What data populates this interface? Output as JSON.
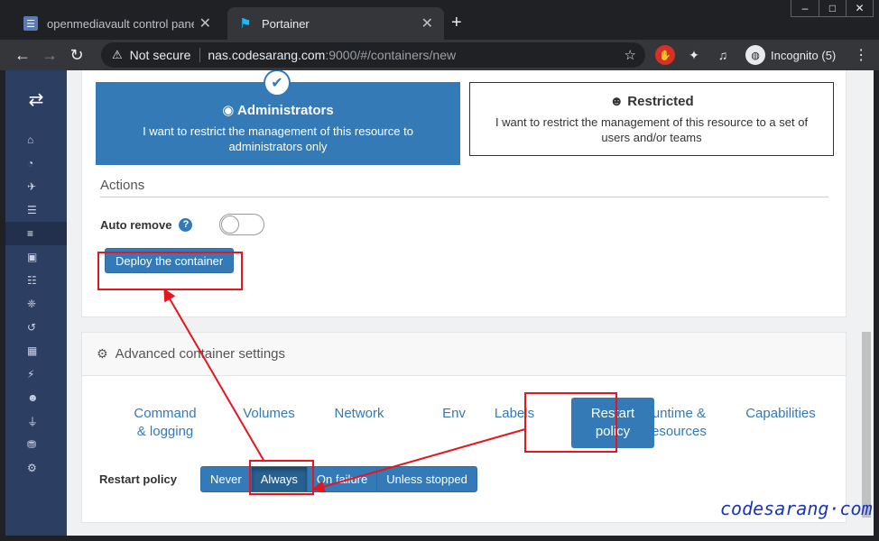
{
  "browser": {
    "tabs": [
      {
        "title": "openmediavault control panel - ",
        "active": false
      },
      {
        "title": "Portainer",
        "active": true
      }
    ],
    "new_tab": "+",
    "window_controls": [
      "–",
      "□",
      "✕"
    ],
    "address": {
      "security": "Not secure",
      "host": "nas.codesarang.com",
      "path": ":9000/#/containers/new"
    },
    "incognito_label": "Incognito (5)"
  },
  "sidebar": {
    "logo": "⇄",
    "items": [
      {
        "icon": "home-icon",
        "glyph": "⌂"
      },
      {
        "icon": "dashboard-icon",
        "glyph": "◔"
      },
      {
        "icon": "rocket-icon",
        "glyph": "✈"
      },
      {
        "icon": "list-icon",
        "glyph": "☰"
      },
      {
        "icon": "containers-icon",
        "glyph": "≡"
      },
      {
        "icon": "images-icon",
        "glyph": "▣"
      },
      {
        "icon": "network-icon",
        "glyph": "☷"
      },
      {
        "icon": "volumes-icon",
        "glyph": "❈"
      },
      {
        "icon": "events-icon",
        "glyph": "↺"
      },
      {
        "icon": "host-icon",
        "glyph": "▦"
      },
      {
        "icon": "bolt-icon",
        "glyph": "⚡"
      },
      {
        "icon": "users-icon",
        "glyph": "☻"
      },
      {
        "icon": "plug-icon",
        "glyph": "⏚"
      },
      {
        "icon": "database-icon",
        "glyph": "⛃"
      },
      {
        "icon": "settings-icon",
        "glyph": "⚙"
      }
    ],
    "active_index": 4
  },
  "access": {
    "administrators": {
      "title": "Administrators",
      "description": "I want to restrict the management of this resource to administrators only"
    },
    "restricted": {
      "title": "Restricted",
      "description": "I want to restrict the management of this resource to a set of users and/or teams"
    }
  },
  "actions": {
    "section_title": "Actions",
    "auto_remove_label": "Auto remove",
    "auto_remove_enabled": false,
    "deploy_label": "Deploy the container"
  },
  "advanced": {
    "title": "Advanced container settings",
    "tabs": [
      {
        "label": "Command\n& logging"
      },
      {
        "label": "Volumes"
      },
      {
        "label": "Network"
      },
      {
        "label": "Env"
      },
      {
        "label": "Labels"
      },
      {
        "label": "Restart\npolicy",
        "active": true
      },
      {
        "label": "Runtime &\nResources"
      },
      {
        "label": "Capabilities"
      }
    ],
    "restart_policy_label": "Restart policy",
    "restart_options": [
      "Never",
      "Always",
      "On failure",
      "Unless stopped"
    ],
    "restart_selected": "Always"
  },
  "watermark": "codesarang·com",
  "colors": {
    "primary": "#337ab7",
    "sidebar": "#2d3e63",
    "annotation": "#e8141e"
  }
}
